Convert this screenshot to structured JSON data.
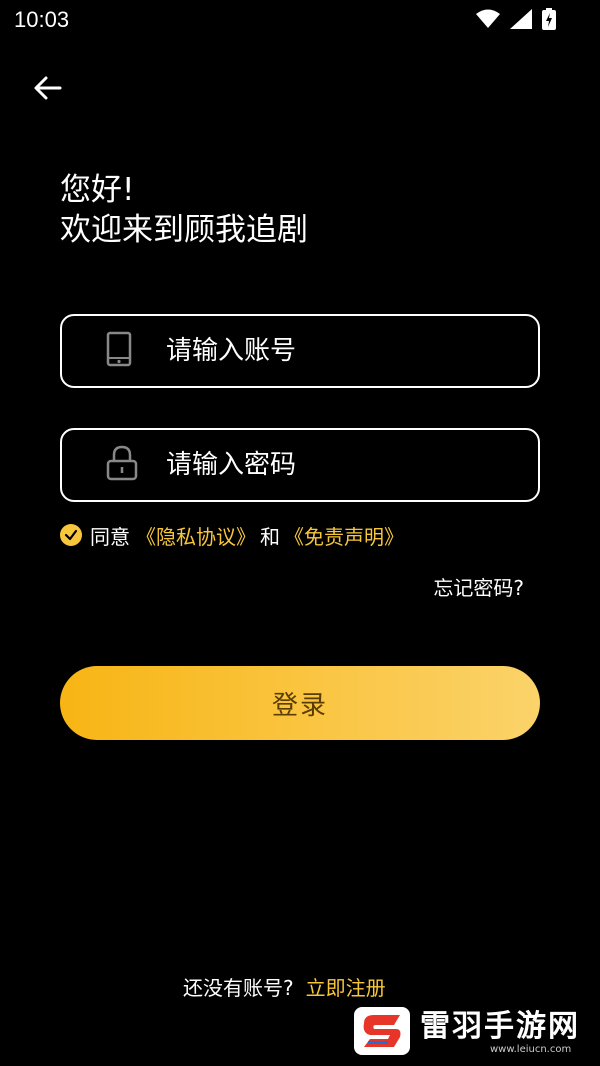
{
  "status_bar": {
    "time": "10:03"
  },
  "greeting": {
    "line1": "您好!",
    "line2": "欢迎来到顾我追剧"
  },
  "account_field": {
    "placeholder": "请输入账号",
    "value": ""
  },
  "password_field": {
    "placeholder": "请输入密码",
    "value": ""
  },
  "agreement": {
    "checked": true,
    "prefix": "同意",
    "privacy_link": "《隐私协议》",
    "and": "和",
    "disclaimer_link": "《免责声明》"
  },
  "forgot_password": "忘记密码?",
  "login_button": "登录",
  "register": {
    "question": "还没有账号?",
    "link": "立即注册"
  },
  "watermark": {
    "title": "雷羽手游网",
    "url": "www.leiucn.com"
  },
  "colors": {
    "background": "#000000",
    "accent": "#f7c63a",
    "button_start": "#f8b514",
    "button_end": "#fbd36a"
  }
}
